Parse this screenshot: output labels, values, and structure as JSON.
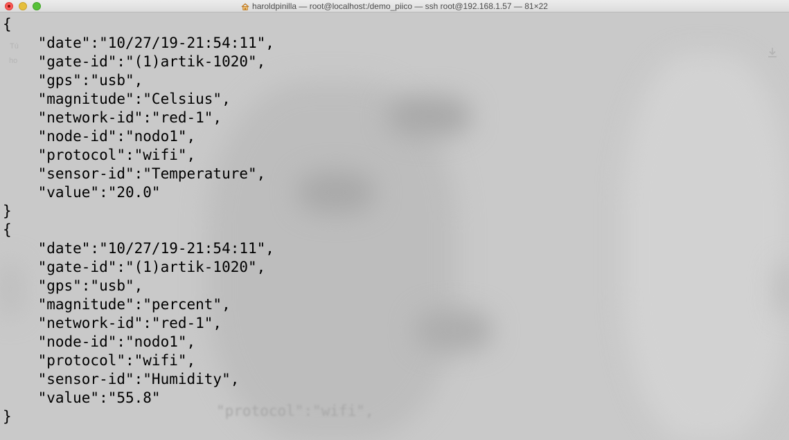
{
  "window": {
    "title": "haroldpinilla — root@localhost:/demo_piico — ssh root@192.168.1.57 — 81×22",
    "title_icon": "home-icon",
    "buttons": [
      "close",
      "minimize",
      "zoom"
    ]
  },
  "terminal": {
    "lines": [
      "{",
      "    \"date\":\"10/27/19-21:54:11\",",
      "    \"gate-id\":\"(1)artik-1020\",",
      "    \"gps\":\"usb\",",
      "    \"magnitude\":\"Celsius\",",
      "    \"network-id\":\"red-1\",",
      "    \"node-id\":\"nodo1\",",
      "    \"protocol\":\"wifi\",",
      "    \"sensor-id\":\"Temperature\",",
      "    \"value\":\"20.0\"",
      "}",
      "{",
      "    \"date\":\"10/27/19-21:54:11\",",
      "    \"gate-id\":\"(1)artik-1020\",",
      "    \"gps\":\"usb\",",
      "    \"magnitude\":\"percent\",",
      "    \"network-id\":\"red-1\",",
      "    \"node-id\":\"nodo1\",",
      "    \"protocol\":\"wifi\",",
      "    \"sensor-id\":\"Humidity\",",
      "    \"value\":\"55.8\"",
      "}"
    ]
  },
  "background": {
    "ghost_text": "\"protocol\":\"wifi\",",
    "side_glyph_1": "Tú",
    "side_glyph_2": "ho"
  },
  "colors": {
    "close": "#fc5b57",
    "minimize": "#e5bf3c",
    "zoom": "#57c038",
    "terminal_text": "#000000",
    "terminal_bg": "#c9c9c9"
  }
}
